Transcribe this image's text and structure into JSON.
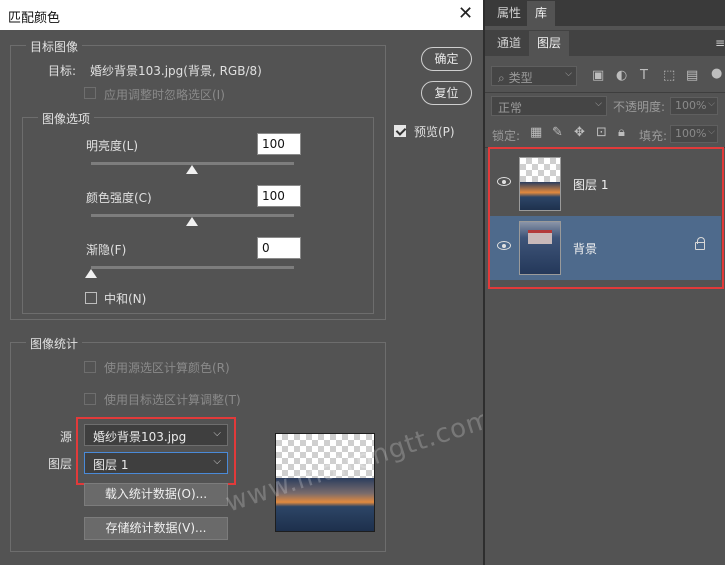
{
  "dialog": {
    "title": "匹配颜色",
    "close_icon": "close-icon",
    "target_image": {
      "group_title": "目标图像",
      "target_label": "目标:",
      "target_value": "婚纱背景103.jpg(背景, RGB/8)",
      "ignore_selection_label": "应用调整时忽略选区(I)"
    },
    "image_options": {
      "group_title": "图像选项",
      "luminance_label": "明亮度(L)",
      "luminance_value": "100",
      "luminance_level": 100,
      "color_intensity_label": "颜色强度(C)",
      "color_intensity_value": "100",
      "color_intensity_level": 100,
      "fade_label": "渐隐(F)",
      "fade_value": "0",
      "fade_level": 0,
      "neutralize_label": "中和(N)"
    },
    "buttons": {
      "ok": "确定",
      "reset": "复位"
    },
    "preview": {
      "label": "预览(P)",
      "checked": true
    },
    "image_statistics": {
      "group_title": "图像统计",
      "use_source_selection_label": "使用源选区计算颜色(R)",
      "use_target_selection_label": "使用目标选区计算调整(T)",
      "source_label": "源",
      "source_value": "婚纱背景103.jpg",
      "layer_label": "图层",
      "layer_value": "图层 1",
      "load_stats_label": "载入统计数据(O)...",
      "save_stats_label": "存储统计数据(V)..."
    },
    "watermark": "www.mairongtt.com"
  },
  "panel": {
    "tabs_top": [
      "属性",
      "库"
    ],
    "tabs_layers": [
      "通道",
      "图层"
    ],
    "menu_icon": "panel-menu-icon",
    "filter_kind": "类型",
    "blend_mode": "正常",
    "opacity_label": "不透明度:",
    "opacity_value": "100%",
    "lock_label": "锁定:",
    "fill_label": "填充:",
    "fill_value": "100%",
    "layers": [
      {
        "name": "图层 1",
        "visible": true,
        "selected": false,
        "locked": false
      },
      {
        "name": "背景",
        "visible": true,
        "selected": true,
        "locked": true
      }
    ]
  },
  "colors": {
    "dialog_bg": "#535353",
    "highlight_red": "#e23a3a",
    "selected_layer": "#4e6a8c"
  }
}
